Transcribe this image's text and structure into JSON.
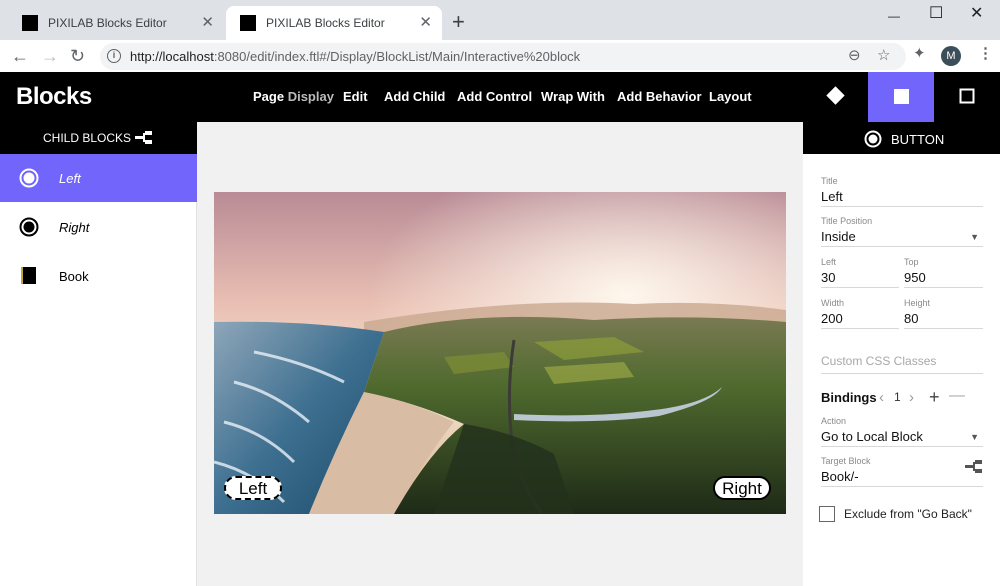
{
  "browser": {
    "tabs": [
      {
        "title": "PIXILAB Blocks Editor",
        "active": false
      },
      {
        "title": "PIXILAB Blocks Editor",
        "active": true
      }
    ],
    "url_host": "http://localhost",
    "url_rest": ":8080/edit/index.ftl#/Display/BlockList/Main/Interactive%20block",
    "profile_initial": "M",
    "close_glyph": "✕",
    "new_tab_glyph": "+",
    "minimize_glyph": "—",
    "maximize_glyph": "☐",
    "window_close_glyph": "✕",
    "back_glyph": "←",
    "forward_glyph": "→",
    "reload_glyph": "↻",
    "info_glyph": "i",
    "zoom_glyph": "⊖",
    "star_glyph": "☆",
    "extensions_glyph": "✦",
    "menu_glyph": "⋮"
  },
  "app": {
    "logo": "Blocks",
    "menu": {
      "page": "Page",
      "display": "Display",
      "edit": "Edit",
      "add_child": "Add Child",
      "add_control": "Add Control",
      "wrap_with": "Wrap With",
      "add_behavior": "Add Behavior",
      "layout": "Layout"
    },
    "accent_color": "#7165fb"
  },
  "left_panel": {
    "title": "CHILD BLOCKS",
    "items": [
      {
        "label": "Left",
        "selected": true,
        "icon": "radio-button-icon"
      },
      {
        "label": "Right",
        "selected": false,
        "icon": "radio-button-icon"
      },
      {
        "label": "Book",
        "selected": false,
        "icon": "book-icon"
      }
    ]
  },
  "canvas": {
    "buttons": {
      "left": "Left",
      "right": "Right"
    }
  },
  "properties": {
    "header": "BUTTON",
    "title_label": "Title",
    "title_value": "Left",
    "title_position_label": "Title Position",
    "title_position_value": "Inside",
    "left_label": "Left",
    "left_value": "30",
    "top_label": "Top",
    "top_value": "950",
    "width_label": "Width",
    "width_value": "200",
    "height_label": "Height",
    "height_value": "80",
    "css_placeholder": "Custom CSS Classes",
    "bindings_label": "Bindings",
    "bindings_index": "1",
    "action_label": "Action",
    "action_value": "Go to Local Block",
    "target_label": "Target Block",
    "target_value": "Book/-",
    "exclude_label": "Exclude from \"Go Back\""
  }
}
